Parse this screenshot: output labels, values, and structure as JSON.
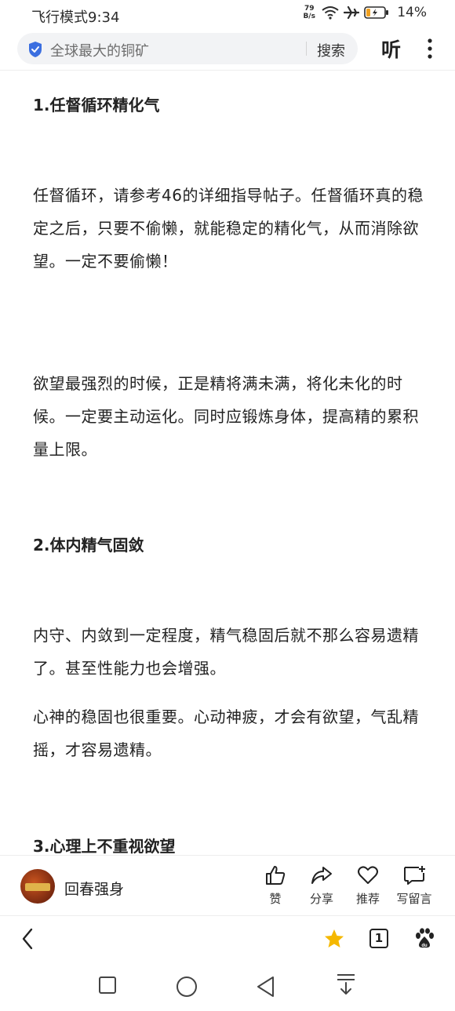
{
  "status_bar": {
    "left_text": "飞行模式9:34",
    "net_speed_value": "79",
    "net_speed_unit": "B/s",
    "battery_percent": "14%"
  },
  "search": {
    "query": "全球最大的铜矿",
    "button_label": "搜索",
    "listen_label": "听"
  },
  "article": {
    "heading_1": "1.任督循环精化气",
    "para_1": "任督循环，请参考46的详细指导帖子。任督循环真的稳定之后，只要不偷懒，就能稳定的精化气，从而消除欲望。一定不要偷懒！",
    "para_2": "欲望最强烈的时候，正是精将满未满，将化未化的时候。一定要主动运化。同时应锻炼身体，提高精的累积量上限。",
    "heading_2": "2.体内精气固敛",
    "para_3": "内守、内敛到一定程度，精气稳固后就不那么容易遗精了。甚至性能力也会增强。",
    "para_4": "心神的稳固也很重要。心动神疲，才会有欲望，气乱精摇，才容易遗精。",
    "heading_3": "3.心理上不重视欲望"
  },
  "author_bar": {
    "author_name": "回春强身",
    "actions": {
      "like": "赞",
      "share": "分享",
      "recommend": "推荐",
      "comment": "写留言"
    }
  },
  "nav_bar": {
    "tab_count": "1",
    "icons": [
      "back-icon",
      "star-icon",
      "tab-count-icon",
      "baidu-paw-icon"
    ]
  },
  "system_nav": {
    "icons": [
      "recent-apps-icon",
      "home-icon",
      "back-triangle-icon",
      "notification-pull-icon"
    ]
  },
  "colors": {
    "accent_blue": "#3b6fe0",
    "star_yellow": "#f5b800",
    "search_bg": "#f2f3f5"
  }
}
